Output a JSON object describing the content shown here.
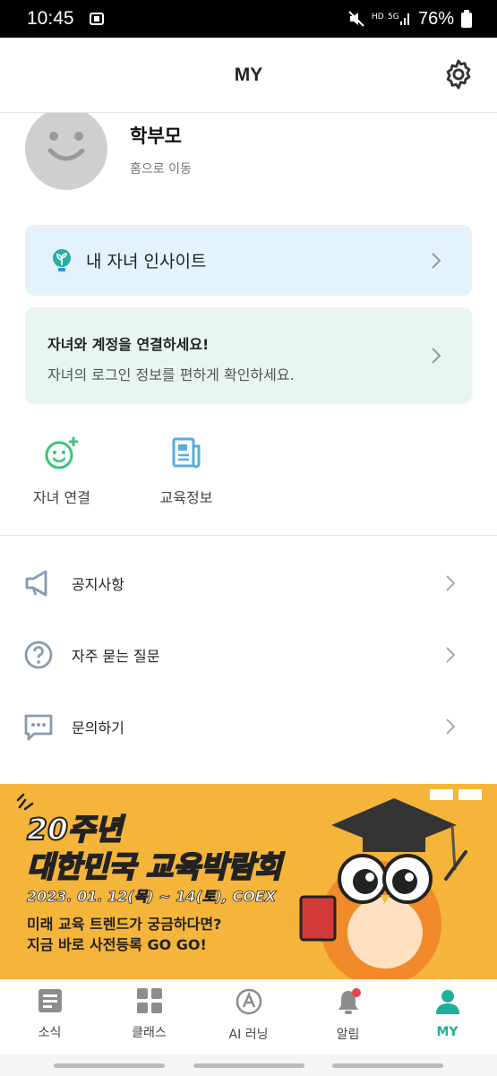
{
  "status_bar": {
    "time": "10:45",
    "battery": "76%"
  },
  "header": {
    "title": "MY"
  },
  "profile": {
    "name": "학부모",
    "link": "홈으로 이동"
  },
  "insight_card": {
    "label": "내 자녀 인사이트"
  },
  "connect_card": {
    "title": "자녀와 계정을 연결하세요!",
    "subtitle": "자녀의 로그인 정보를 편하게 확인하세요."
  },
  "quick_actions": [
    {
      "label": "자녀 연결",
      "icon": "smile-plus-icon"
    },
    {
      "label": "교육정보",
      "icon": "news-icon"
    }
  ],
  "menu": [
    {
      "label": "공지사항",
      "icon": "megaphone-icon"
    },
    {
      "label": "자주 묻는 질문",
      "icon": "question-icon"
    },
    {
      "label": "문의하기",
      "icon": "chat-icon"
    }
  ],
  "banner": {
    "line1": "20주년",
    "line2": "대한민국 교육박람회",
    "line3": "2023. 01. 12(목) ~ 14(토), COEX",
    "line4": "미래 교육 트렌드가 궁금하다면?",
    "line5": "지금 바로 사전등록 GO GO!"
  },
  "tabs": [
    {
      "label": "소식",
      "icon": "news-icon"
    },
    {
      "label": "클래스",
      "icon": "grid-icon"
    },
    {
      "label": "AI 러닝",
      "icon": "ai-icon"
    },
    {
      "label": "알림",
      "icon": "bell-icon"
    },
    {
      "label": "MY",
      "icon": "person-icon",
      "active": true
    }
  ],
  "colors": {
    "accent": "#1db19a",
    "insight_bg": "#e4f2fb",
    "connect_bg": "#e8f6f3",
    "banner_bg": "#f5b43a"
  }
}
